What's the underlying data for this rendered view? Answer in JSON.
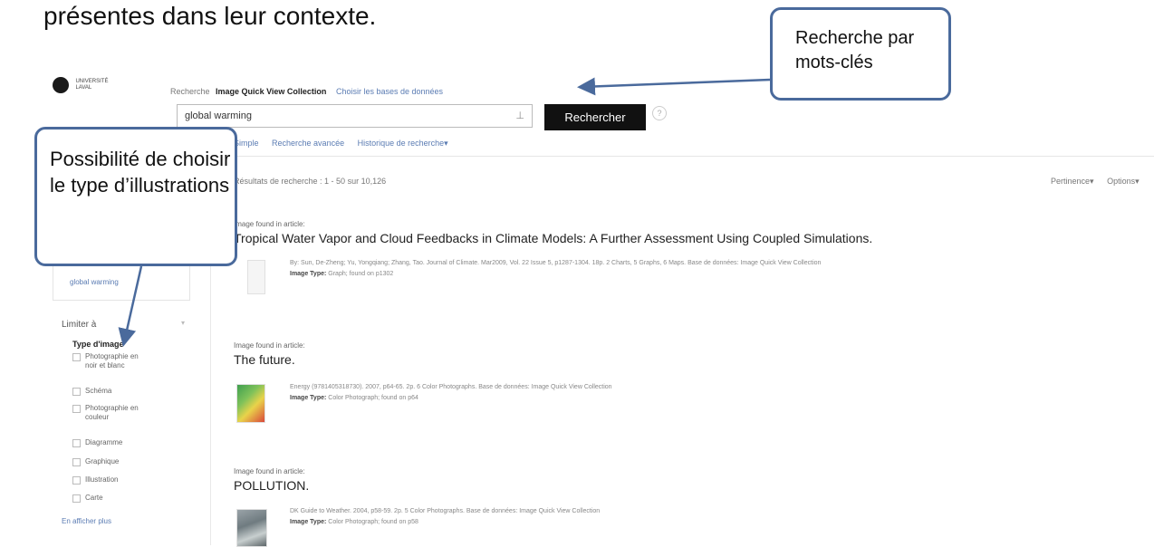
{
  "slide": {
    "text": "présentes dans leur contexte."
  },
  "logo": {
    "text": "UNIVERSITÉ LAVAL"
  },
  "search": {
    "tab_label": "Recherche",
    "collection": "Image Quick View Collection",
    "choose_db": "Choisir les bases de données",
    "query": "global warming",
    "clear_glyph": "⊥",
    "button_label": "Rechercher",
    "help": "?",
    "links": [
      "Simple",
      "Recherche avancée",
      "Historique de recherche▾"
    ]
  },
  "results_header": {
    "summary": "Résultats de recherche : 1 - 50 sur 10,126",
    "sort": "Pertinence▾",
    "options": "Options▾"
  },
  "left_panel": {
    "box_term": "global warming",
    "limit_heading": "Limiter à",
    "type_heading": "Type d'image",
    "facets": [
      "Photographie en noir et blanc",
      "Schéma",
      "Photographie en couleur",
      "Diagramme",
      "Graphique",
      "Illustration",
      "Carte"
    ],
    "more": "En afficher plus"
  },
  "results": [
    {
      "found": "Image found in article:",
      "title": "Tropical Water Vapor and Cloud Feedbacks in Climate Models: A Further Assessment Using Coupled Simulations.",
      "meta": "By: Sun, De-Zheng; Yu, Yongqiang; Zhang, Tao. Journal of Climate. Mar2009, Vol. 22 Issue 5, p1287-1304. 18p. 2 Charts, 5 Graphs, 6 Maps. Base de données: Image Quick View Collection",
      "type_label": "Image Type:",
      "type_value": "Graph; found on p1302"
    },
    {
      "found": "Image found in article:",
      "title": "The future.",
      "meta": "Energy (9781405318730). 2007, p64-65. 2p. 6 Color Photographs. Base de données: Image Quick View Collection",
      "type_label": "Image Type:",
      "type_value": "Color Photograph; found on p64"
    },
    {
      "found": "Image found in article:",
      "title": "POLLUTION.",
      "meta": "DK Guide to Weather. 2004, p58-59. 2p. 5 Color Photographs. Base de données: Image Quick View Collection",
      "type_label": "Image Type:",
      "type_value": "Color Photograph; found on p58"
    }
  ],
  "callouts": {
    "left": "Possibilité de choisir le type d’illustrations",
    "right": "Recherche par mots-clés"
  },
  "colors": {
    "callout_border": "#4a6a9c",
    "link": "#5b7cb3",
    "button": "#111111"
  }
}
